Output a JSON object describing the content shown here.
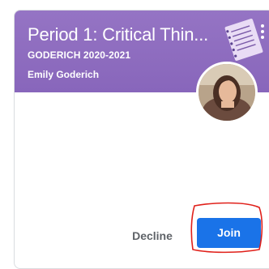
{
  "class_card": {
    "title": "Period 1: Critical Thin...",
    "section": "GODERICH 2020-2021",
    "owner": "Emily Goderich"
  },
  "actions": {
    "decline_label": "Decline",
    "join_label": "Join"
  },
  "icons": {
    "more": "more-vert-icon",
    "banner_art": "notebook-illustration",
    "avatar": "teacher-avatar"
  },
  "colors": {
    "banner": "#8e6fbf",
    "join_button": "#1a73e8",
    "annotation": "#e0201a"
  }
}
